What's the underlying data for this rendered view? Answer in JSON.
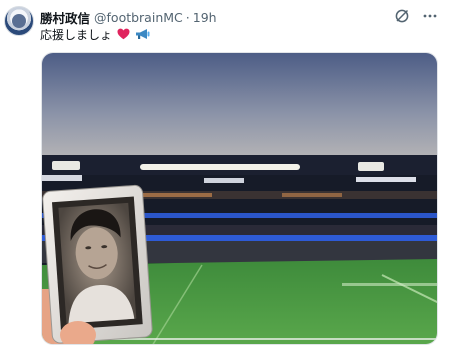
{
  "post": {
    "display_name": "勝村政信",
    "handle": "@footbrainMC",
    "separator": "·",
    "time": "19h",
    "text": "応援しましょ",
    "emojis": [
      "red-heart",
      "megaphone"
    ]
  },
  "icons": {
    "avatar": "profile-avatar",
    "grok": "grok-icon",
    "more": "more-dots-icon"
  },
  "media": {
    "type": "photo",
    "description_colors": {
      "sky_top": "#4d5d86",
      "sky_bottom": "#aeb0b5",
      "pitch": "#4f9a45",
      "stands": "#1a1f2e"
    }
  }
}
